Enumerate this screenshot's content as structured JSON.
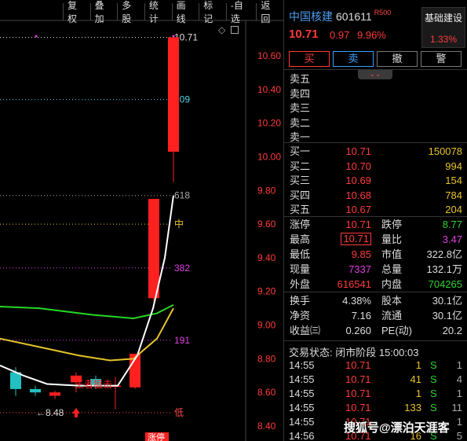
{
  "toolbar": {
    "buttons": [
      "复权",
      "叠加",
      "多股",
      "统计",
      "画线",
      "标记",
      "-自选",
      "返回"
    ]
  },
  "chart": {
    "price_axis": [
      "10.60",
      "10.40",
      "10.20",
      "10.00",
      "9.80",
      "9.60",
      "9.40",
      "9.20",
      "9.00",
      "8.80",
      "8.60",
      "8.40"
    ],
    "level_lines": [
      {
        "label": "10.71",
        "price": 10.71,
        "color": "#dddddd"
      },
      {
        "label": "809",
        "price": 10.34,
        "color": "#4dd8e8"
      },
      {
        "label": "618",
        "price": 9.77,
        "color": "#aaaaaa"
      },
      {
        "label": "中",
        "price": 9.6,
        "color": "#e6c22a"
      },
      {
        "label": "382",
        "price": 9.34,
        "color": "#e040e0"
      },
      {
        "label": "191",
        "price": 8.91,
        "color": "#e040e0"
      },
      {
        "label": "低",
        "price": 8.48,
        "color": "#ff4848"
      }
    ],
    "low_marker": "←8.48",
    "annotation": "王者狙击",
    "bottom_tag": "涨停"
  },
  "quote": {
    "name": "中国核建",
    "code": "601611",
    "tag": "R500",
    "price": "10.71",
    "change": "0.97",
    "pct": "9.96%",
    "fundamentals_label": "基础建设",
    "fundamentals_pct": "1.33%"
  },
  "trade_buttons": [
    "买",
    "卖",
    "撤",
    "警"
  ],
  "collapse_icon": "⌄⌄",
  "sell_levels": [
    {
      "label": "卖五",
      "price": "",
      "vol": ""
    },
    {
      "label": "卖四",
      "price": "",
      "vol": ""
    },
    {
      "label": "卖三",
      "price": "",
      "vol": ""
    },
    {
      "label": "卖二",
      "price": "",
      "vol": ""
    },
    {
      "label": "卖一",
      "price": "",
      "vol": ""
    }
  ],
  "buy_levels": [
    {
      "label": "买一",
      "price": "10.71",
      "vol": "150078"
    },
    {
      "label": "买二",
      "price": "10.70",
      "vol": "994"
    },
    {
      "label": "买三",
      "price": "10.69",
      "vol": "154"
    },
    {
      "label": "买四",
      "price": "10.68",
      "vol": "784"
    },
    {
      "label": "买五",
      "price": "10.67",
      "vol": "204"
    }
  ],
  "stats": [
    {
      "l1": "涨停",
      "v1": "10.71",
      "c1": "red",
      "l2": "跌停",
      "v2": "8.77",
      "c2": "green"
    },
    {
      "l1": "最高",
      "v1": "10.71",
      "c1": "red boxed",
      "l2": "量比",
      "v2": "3.47",
      "c2": "magenta"
    },
    {
      "l1": "最低",
      "v1": "9.85",
      "c1": "red",
      "l2": "市值",
      "v2": "322.8亿",
      "c2": "white"
    },
    {
      "l1": "现量",
      "v1": "7337",
      "c1": "magenta",
      "l2": "总量",
      "v2": "132.1万",
      "c2": "white"
    },
    {
      "l1": "外盘",
      "v1": "616541",
      "c1": "red",
      "l2": "内盘",
      "v2": "704265",
      "c2": "green"
    }
  ],
  "stats2": [
    {
      "l1": "换手",
      "v1": "4.38%",
      "c1": "white",
      "l2": "股本",
      "v2": "30.1亿",
      "c2": "white"
    },
    {
      "l1": "净资",
      "v1": "7.16",
      "c1": "white",
      "l2": "流通",
      "v2": "30.1亿",
      "c2": "white"
    },
    {
      "l1": "收益㈢",
      "v1": "0.260",
      "c1": "white",
      "l2": "PE(动)",
      "v2": "20.2",
      "c2": "white"
    }
  ],
  "status": "交易状态: 闭市阶段 15:00:03",
  "ticks": [
    {
      "time": "14:55",
      "price": "10.71",
      "vol": "1",
      "side": "S",
      "num": "1"
    },
    {
      "time": "14:55",
      "price": "10.71",
      "vol": "41",
      "side": "S",
      "num": "4"
    },
    {
      "time": "14:55",
      "price": "10.71",
      "vol": "1",
      "side": "S",
      "num": "1"
    },
    {
      "time": "14:55",
      "price": "10.71",
      "vol": "133",
      "side": "S",
      "num": "11"
    },
    {
      "time": "14:55",
      "price": "10.71",
      "vol": "",
      "side": "",
      "num": "1"
    },
    {
      "time": "14:56",
      "price": "10.71",
      "vol": "16",
      "side": "S",
      "num": "5"
    }
  ],
  "watermark": "搜狐号@漂泊天涯客"
}
